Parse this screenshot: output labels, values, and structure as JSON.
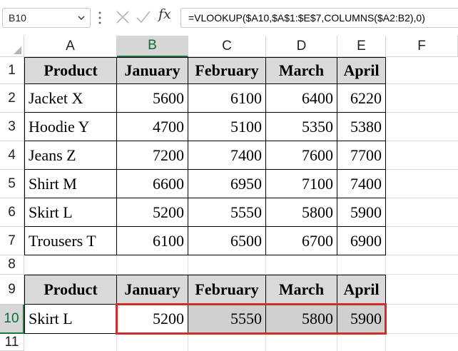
{
  "name_box": {
    "value": "B10"
  },
  "formula_bar": {
    "fx_label": "fx",
    "formula": "=VLOOKUP($A10,$A$1:$E$7,COLUMNS($A2:B2),0)"
  },
  "columns": [
    "A",
    "B",
    "C",
    "D",
    "E",
    "F"
  ],
  "rows": [
    "1",
    "2",
    "3",
    "4",
    "5",
    "6",
    "7",
    "8",
    "9",
    "10",
    "11"
  ],
  "table1": {
    "headers": [
      "Product",
      "January",
      "February",
      "March",
      "April"
    ],
    "rows": [
      [
        "Jacket X",
        "5600",
        "6100",
        "6400",
        "6220"
      ],
      [
        "Hoodie Y",
        "4700",
        "5100",
        "5350",
        "5380"
      ],
      [
        "Jeans Z",
        "7200",
        "7400",
        "7600",
        "7700"
      ],
      [
        "Shirt M",
        "6600",
        "6950",
        "7100",
        "7400"
      ],
      [
        "Skirt L",
        "5200",
        "5550",
        "5800",
        "5900"
      ],
      [
        "Trousers T",
        "6100",
        "6500",
        "6700",
        "6900"
      ]
    ]
  },
  "table2": {
    "headers": [
      "Product",
      "January",
      "February",
      "March",
      "April"
    ],
    "row": [
      "Skirt L",
      "5200",
      "5550",
      "5800",
      "5900"
    ]
  },
  "colors": {
    "selection_green": "#217346",
    "highlight_red": "#d42b2b",
    "header_fill": "#d9d9d9"
  }
}
